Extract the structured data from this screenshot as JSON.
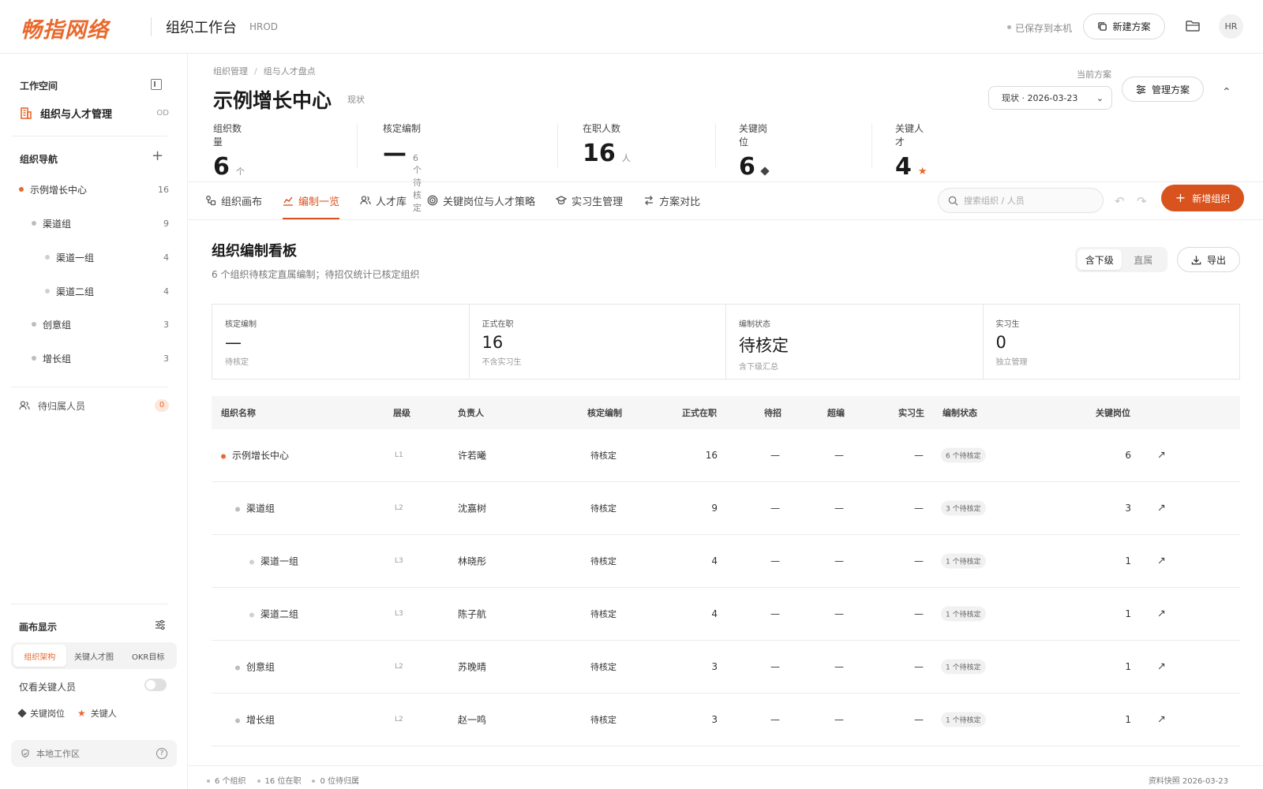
{
  "header": {
    "logo_text": "畅指网络",
    "title": "组织工作台",
    "subtitle": "HROD",
    "saved_text": "已保存到本机",
    "new_plan_label": "新建方案",
    "avatar_text": "HR"
  },
  "sidebar": {
    "workspace_title": "工作空间",
    "workspace_name": "组织与人才管理",
    "workspace_tag": "OD",
    "nav_title": "组织导航",
    "nav_items": [
      {
        "label": "示例增长中心",
        "count": "16"
      },
      {
        "label": "渠道组",
        "count": "9"
      },
      {
        "label": "渠道一组",
        "count": "4"
      },
      {
        "label": "渠道二组",
        "count": "4"
      },
      {
        "label": "创意组",
        "count": "3"
      },
      {
        "label": "增长组",
        "count": "3"
      }
    ],
    "pending_label": "待归属人员",
    "pending_count": "0",
    "canvas_title": "画布显示",
    "canvas_modes": [
      "组织架构",
      "关键人才图",
      "OKR目标"
    ],
    "only_key_label": "仅看关键人员",
    "legend_key_post": "关键岗位",
    "legend_key_person": "关键人",
    "local_ws": "本地工作区"
  },
  "main": {
    "breadcrumb": [
      "组织管理",
      "组与人才盘点"
    ],
    "page_title": "示例增长中心",
    "page_status": "现状",
    "current_plan_label": "当前方案",
    "plan_select": "现状 · 2026-03-23",
    "manage_plan_label": "管理方案",
    "stats": [
      {
        "label": "组织数量",
        "value": "6",
        "unit": "个"
      },
      {
        "label": "核定编制",
        "value": "—",
        "unit": "6 个待核定"
      },
      {
        "label": "在职人数",
        "value": "16",
        "unit": "人"
      },
      {
        "label": "关键岗位",
        "value": "6",
        "unit": ""
      },
      {
        "label": "关键人才",
        "value": "4",
        "unit": ""
      }
    ],
    "tabs": [
      "组织画布",
      "编制一览",
      "人才库",
      "关键岗位与人才策略",
      "实习生管理",
      "方案对比"
    ],
    "search_placeholder": "搜索组织 / 人员",
    "add_org_label": "新增组织",
    "board_title": "组织编制看板",
    "board_desc": "6 个组织待核定直属编制；待招仅统计已核定组织",
    "scope_options": [
      "含下级",
      "直属"
    ],
    "export_label": "导出",
    "cards": [
      {
        "label": "核定编制",
        "value": "—",
        "sub": "待核定"
      },
      {
        "label": "正式在职",
        "value": "16",
        "sub": "不含实习生"
      },
      {
        "label": "编制状态",
        "value": "待核定",
        "sub": "含下级汇总"
      },
      {
        "label": "实习生",
        "value": "0",
        "sub": "独立管理"
      }
    ],
    "table_headers": [
      "组织名称",
      "层级",
      "负责人",
      "核定编制",
      "正式在职",
      "待招",
      "超编",
      "实习生",
      "编制状态",
      "关键岗位"
    ],
    "rows": [
      {
        "name": "示例增长中心",
        "level": "L1",
        "owner": "许若曦",
        "quota": "待核定",
        "active": "16",
        "hiring": "—",
        "over": "—",
        "intern": "—",
        "status": "6 个待核定",
        "key": "6"
      },
      {
        "name": "渠道组",
        "level": "L2",
        "owner": "沈嘉树",
        "quota": "待核定",
        "active": "9",
        "hiring": "—",
        "over": "—",
        "intern": "—",
        "status": "3 个待核定",
        "key": "3"
      },
      {
        "name": "渠道一组",
        "level": "L3",
        "owner": "林晓彤",
        "quota": "待核定",
        "active": "4",
        "hiring": "—",
        "over": "—",
        "intern": "—",
        "status": "1 个待核定",
        "key": "1"
      },
      {
        "name": "渠道二组",
        "level": "L3",
        "owner": "陈子航",
        "quota": "待核定",
        "active": "4",
        "hiring": "—",
        "over": "—",
        "intern": "—",
        "status": "1 个待核定",
        "key": "1"
      },
      {
        "name": "创意组",
        "level": "L2",
        "owner": "苏晚晴",
        "quota": "待核定",
        "active": "3",
        "hiring": "—",
        "over": "—",
        "intern": "—",
        "status": "1 个待核定",
        "key": "1"
      },
      {
        "name": "增长组",
        "level": "L2",
        "owner": "赵一鸣",
        "quota": "待核定",
        "active": "3",
        "hiring": "—",
        "over": "—",
        "intern": "—",
        "status": "1 个待核定",
        "key": "1"
      }
    ],
    "footer_items": [
      "6 个组织",
      "16 位在职",
      "0 位待归属"
    ],
    "footer_snapshot": "资料快照 2026-03-23"
  },
  "colors": {
    "accent": "#d9531e",
    "brand": "#e9692c"
  }
}
